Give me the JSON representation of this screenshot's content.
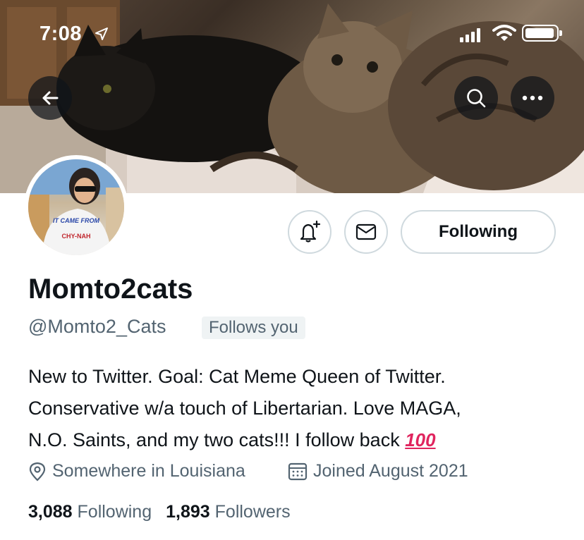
{
  "status_bar": {
    "time": "7:08"
  },
  "banner": {
    "description_icons": [
      "back-arrow-icon",
      "search-icon",
      "more-icon"
    ]
  },
  "avatar": {
    "shirt_text_line1": "IT CAME FROM",
    "shirt_text_line2": "CHY-NAH"
  },
  "actions": {
    "following_label": "Following"
  },
  "profile": {
    "display_name": "Momto2cats",
    "handle": "@Momto2_Cats",
    "follows_you": "Follows you",
    "bio_line1": "New to Twitter. Goal: Cat Meme Queen of Twitter.",
    "bio_line2": "Conservative w/a touch of Libertarian. Love MAGA,",
    "bio_line3": "N.O. Saints, and my two cats!!! I follow back",
    "bio_emoji": "100",
    "location": "Somewhere in Louisiana",
    "joined": "Joined August 2021",
    "following_count": "3,088",
    "following_label": "Following",
    "followers_count": "1,893",
    "followers_label": "Followers"
  },
  "colors": {
    "text_primary": "#0f1419",
    "text_secondary": "#536471",
    "border": "#cfd9de",
    "badge_bg": "#eff3f4",
    "emoji_red": "#e0245e"
  }
}
